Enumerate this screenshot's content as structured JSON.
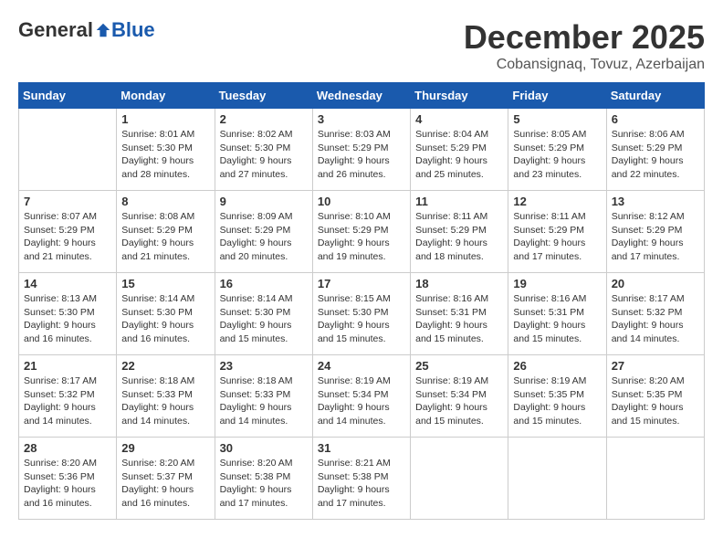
{
  "header": {
    "logo_general": "General",
    "logo_blue": "Blue",
    "month_title": "December 2025",
    "subtitle": "Cobansignaq, Tovuz, Azerbaijan"
  },
  "weekdays": [
    "Sunday",
    "Monday",
    "Tuesday",
    "Wednesday",
    "Thursday",
    "Friday",
    "Saturday"
  ],
  "weeks": [
    [
      {
        "day": "",
        "info": ""
      },
      {
        "day": "1",
        "info": "Sunrise: 8:01 AM\nSunset: 5:30 PM\nDaylight: 9 hours\nand 28 minutes."
      },
      {
        "day": "2",
        "info": "Sunrise: 8:02 AM\nSunset: 5:30 PM\nDaylight: 9 hours\nand 27 minutes."
      },
      {
        "day": "3",
        "info": "Sunrise: 8:03 AM\nSunset: 5:29 PM\nDaylight: 9 hours\nand 26 minutes."
      },
      {
        "day": "4",
        "info": "Sunrise: 8:04 AM\nSunset: 5:29 PM\nDaylight: 9 hours\nand 25 minutes."
      },
      {
        "day": "5",
        "info": "Sunrise: 8:05 AM\nSunset: 5:29 PM\nDaylight: 9 hours\nand 23 minutes."
      },
      {
        "day": "6",
        "info": "Sunrise: 8:06 AM\nSunset: 5:29 PM\nDaylight: 9 hours\nand 22 minutes."
      }
    ],
    [
      {
        "day": "7",
        "info": "Sunrise: 8:07 AM\nSunset: 5:29 PM\nDaylight: 9 hours\nand 21 minutes."
      },
      {
        "day": "8",
        "info": "Sunrise: 8:08 AM\nSunset: 5:29 PM\nDaylight: 9 hours\nand 21 minutes."
      },
      {
        "day": "9",
        "info": "Sunrise: 8:09 AM\nSunset: 5:29 PM\nDaylight: 9 hours\nand 20 minutes."
      },
      {
        "day": "10",
        "info": "Sunrise: 8:10 AM\nSunset: 5:29 PM\nDaylight: 9 hours\nand 19 minutes."
      },
      {
        "day": "11",
        "info": "Sunrise: 8:11 AM\nSunset: 5:29 PM\nDaylight: 9 hours\nand 18 minutes."
      },
      {
        "day": "12",
        "info": "Sunrise: 8:11 AM\nSunset: 5:29 PM\nDaylight: 9 hours\nand 17 minutes."
      },
      {
        "day": "13",
        "info": "Sunrise: 8:12 AM\nSunset: 5:29 PM\nDaylight: 9 hours\nand 17 minutes."
      }
    ],
    [
      {
        "day": "14",
        "info": "Sunrise: 8:13 AM\nSunset: 5:30 PM\nDaylight: 9 hours\nand 16 minutes."
      },
      {
        "day": "15",
        "info": "Sunrise: 8:14 AM\nSunset: 5:30 PM\nDaylight: 9 hours\nand 16 minutes."
      },
      {
        "day": "16",
        "info": "Sunrise: 8:14 AM\nSunset: 5:30 PM\nDaylight: 9 hours\nand 15 minutes."
      },
      {
        "day": "17",
        "info": "Sunrise: 8:15 AM\nSunset: 5:30 PM\nDaylight: 9 hours\nand 15 minutes."
      },
      {
        "day": "18",
        "info": "Sunrise: 8:16 AM\nSunset: 5:31 PM\nDaylight: 9 hours\nand 15 minutes."
      },
      {
        "day": "19",
        "info": "Sunrise: 8:16 AM\nSunset: 5:31 PM\nDaylight: 9 hours\nand 15 minutes."
      },
      {
        "day": "20",
        "info": "Sunrise: 8:17 AM\nSunset: 5:32 PM\nDaylight: 9 hours\nand 14 minutes."
      }
    ],
    [
      {
        "day": "21",
        "info": "Sunrise: 8:17 AM\nSunset: 5:32 PM\nDaylight: 9 hours\nand 14 minutes."
      },
      {
        "day": "22",
        "info": "Sunrise: 8:18 AM\nSunset: 5:33 PM\nDaylight: 9 hours\nand 14 minutes."
      },
      {
        "day": "23",
        "info": "Sunrise: 8:18 AM\nSunset: 5:33 PM\nDaylight: 9 hours\nand 14 minutes."
      },
      {
        "day": "24",
        "info": "Sunrise: 8:19 AM\nSunset: 5:34 PM\nDaylight: 9 hours\nand 14 minutes."
      },
      {
        "day": "25",
        "info": "Sunrise: 8:19 AM\nSunset: 5:34 PM\nDaylight: 9 hours\nand 15 minutes."
      },
      {
        "day": "26",
        "info": "Sunrise: 8:19 AM\nSunset: 5:35 PM\nDaylight: 9 hours\nand 15 minutes."
      },
      {
        "day": "27",
        "info": "Sunrise: 8:20 AM\nSunset: 5:35 PM\nDaylight: 9 hours\nand 15 minutes."
      }
    ],
    [
      {
        "day": "28",
        "info": "Sunrise: 8:20 AM\nSunset: 5:36 PM\nDaylight: 9 hours\nand 16 minutes."
      },
      {
        "day": "29",
        "info": "Sunrise: 8:20 AM\nSunset: 5:37 PM\nDaylight: 9 hours\nand 16 minutes."
      },
      {
        "day": "30",
        "info": "Sunrise: 8:20 AM\nSunset: 5:38 PM\nDaylight: 9 hours\nand 17 minutes."
      },
      {
        "day": "31",
        "info": "Sunrise: 8:21 AM\nSunset: 5:38 PM\nDaylight: 9 hours\nand 17 minutes."
      },
      {
        "day": "",
        "info": ""
      },
      {
        "day": "",
        "info": ""
      },
      {
        "day": "",
        "info": ""
      }
    ]
  ]
}
